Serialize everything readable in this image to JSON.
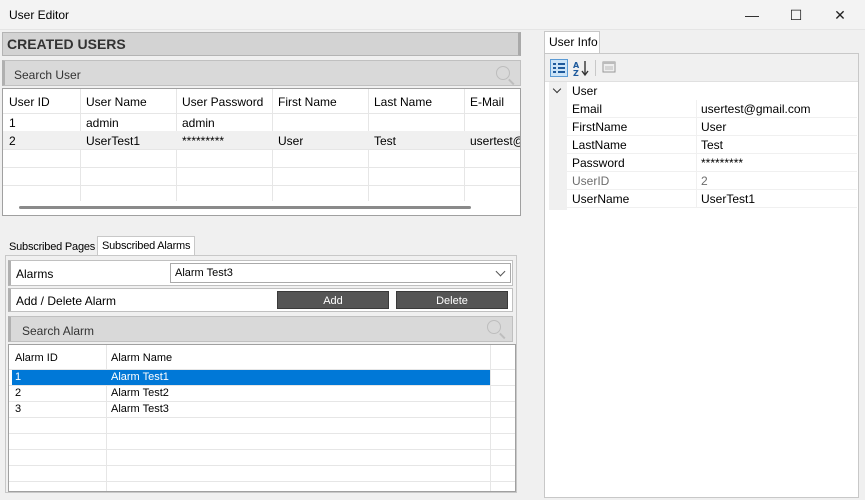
{
  "window": {
    "title": "User Editor",
    "controls": {
      "minimize": "—",
      "maximize": "☐",
      "close": "✕"
    }
  },
  "created_users": {
    "header": "CREATED USERS",
    "search_label": "Search User",
    "columns": [
      "User ID",
      "User Name",
      "User Password",
      "First Name",
      "Last Name",
      "E-Mail"
    ],
    "rows": [
      [
        "1",
        "admin",
        "admin",
        "",
        "",
        ""
      ],
      [
        "2",
        "UserTest1",
        "*********",
        "User",
        "Test",
        "usertest@"
      ]
    ]
  },
  "tabs": {
    "items": [
      "Subscribed Pages",
      "Subscribed Alarms"
    ],
    "active": "Subscribed Alarms"
  },
  "alarms": {
    "label": "Alarms",
    "selected": "Alarm Test3",
    "add_delete_label": "Add / Delete Alarm",
    "add_button": "Add",
    "delete_button": "Delete",
    "search_label": "Search Alarm",
    "columns": [
      "Alarm ID",
      "Alarm Name"
    ],
    "rows": [
      [
        "1",
        "Alarm Test1"
      ],
      [
        "2",
        "Alarm Test2"
      ],
      [
        "3",
        "Alarm Test3"
      ]
    ],
    "selected_row": "1"
  },
  "user_info": {
    "tab_label": "User Info",
    "category": "User",
    "properties": [
      {
        "name": "Email",
        "value": "usertest@gmail.com",
        "readonly": false
      },
      {
        "name": "FirstName",
        "value": "User",
        "readonly": false
      },
      {
        "name": "LastName",
        "value": "Test",
        "readonly": false
      },
      {
        "name": "Password",
        "value": "*********",
        "readonly": false
      },
      {
        "name": "UserID",
        "value": "2",
        "readonly": true
      },
      {
        "name": "UserName",
        "value": "UserTest1",
        "readonly": false
      }
    ]
  },
  "colors": {
    "selection": "#0078d7",
    "button_dark": "#555555",
    "header_gray": "#d3d3d3"
  }
}
